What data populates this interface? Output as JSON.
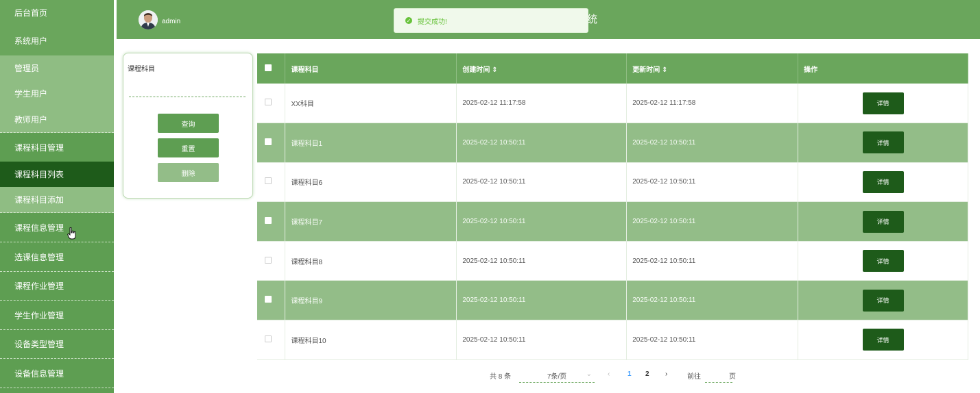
{
  "sidebar": {
    "items": [
      {
        "label": "后台首页"
      },
      {
        "label": "系统用户"
      },
      {
        "label": "管理员"
      },
      {
        "label": "学生用户"
      },
      {
        "label": "教师用户"
      },
      {
        "label": "课程科目管理"
      },
      {
        "label": "课程科目列表"
      },
      {
        "label": "课程科目添加"
      },
      {
        "label": "课程信息管理"
      },
      {
        "label": "选课信息管理"
      },
      {
        "label": "课程作业管理"
      },
      {
        "label": "学生作业管理"
      },
      {
        "label": "设备类型管理"
      },
      {
        "label": "设备信息管理"
      }
    ]
  },
  "header": {
    "user": "admin",
    "title_fragment": "统"
  },
  "toast": {
    "message": "提交成功!"
  },
  "search": {
    "label": "课程科目",
    "query_label": "查询",
    "reset_label": "重置",
    "delete_label": "删除"
  },
  "table": {
    "columns": [
      "课程科目",
      "创建时间 ⇕",
      "更新时间 ⇕",
      "操作"
    ],
    "rows": [
      {
        "name": "XX科目",
        "created": "2025-02-12 11:17:58",
        "updated": "2025-02-12 11:17:58",
        "action": "详情"
      },
      {
        "name": "课程科目1",
        "created": "2025-02-12 10:50:11",
        "updated": "2025-02-12 10:50:11",
        "action": "详情"
      },
      {
        "name": "课程科目6",
        "created": "2025-02-12 10:50:11",
        "updated": "2025-02-12 10:50:11",
        "action": "详情"
      },
      {
        "name": "课程科目7",
        "created": "2025-02-12 10:50:11",
        "updated": "2025-02-12 10:50:11",
        "action": "详情"
      },
      {
        "name": "课程科目8",
        "created": "2025-02-12 10:50:11",
        "updated": "2025-02-12 10:50:11",
        "action": "详情"
      },
      {
        "name": "课程科目9",
        "created": "2025-02-12 10:50:11",
        "updated": "2025-02-12 10:50:11",
        "action": "详情"
      },
      {
        "name": "课程科目10",
        "created": "2025-02-12 10:50:11",
        "updated": "2025-02-12 10:50:11",
        "action": "详情"
      }
    ]
  },
  "pagination": {
    "total": "共 8 条",
    "page_size": "7条/页",
    "pages": [
      "1",
      "2"
    ],
    "goto_prefix": "前往",
    "goto_suffix": "页"
  },
  "colors": {
    "accent": "#6aa65c",
    "dark": "#1e5b1a",
    "row_alt": "#93bd88"
  }
}
